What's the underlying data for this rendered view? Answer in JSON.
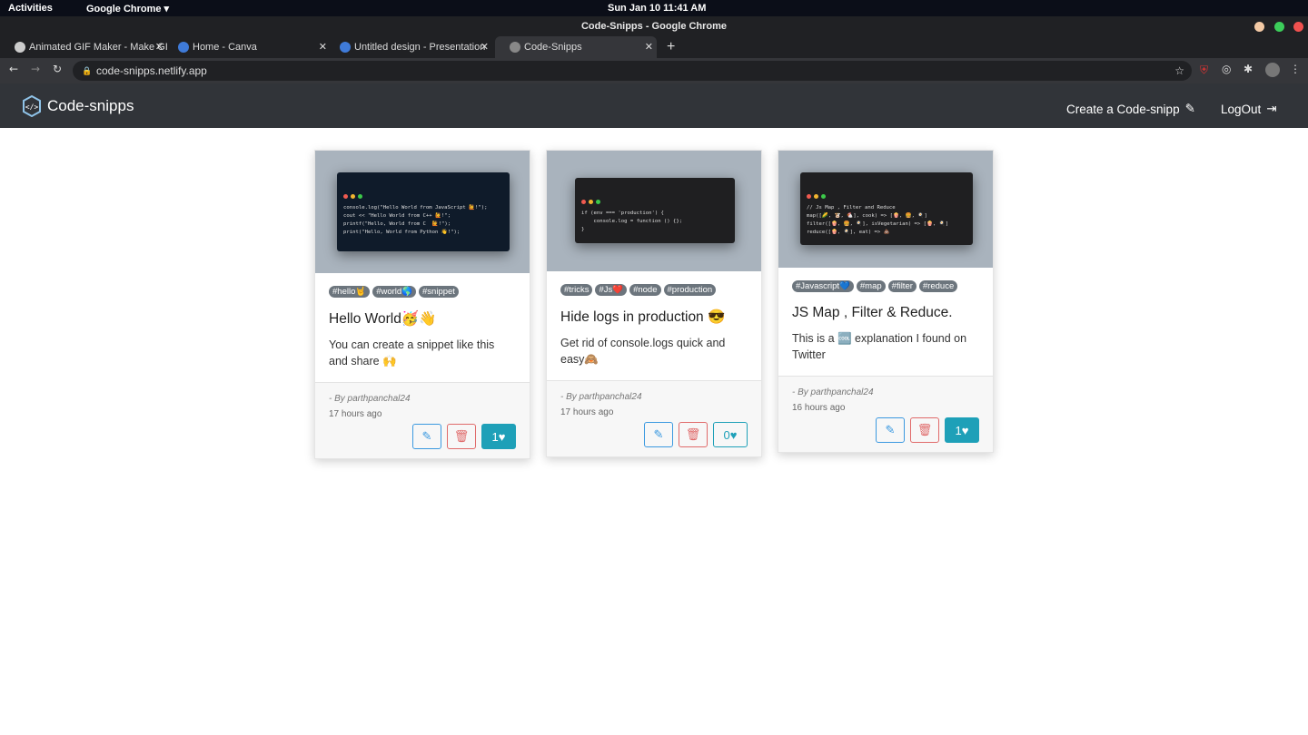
{
  "system": {
    "activities": "Activities",
    "app": "Google Chrome ▾",
    "clock": "Sun Jan 10  11:41 AM"
  },
  "window": {
    "title": "Code-Snipps - Google Chrome"
  },
  "tabs": [
    {
      "label": "Animated GIF Maker - Make GIFs"
    },
    {
      "label": "Home - Canva"
    },
    {
      "label": "Untitled design - Presentation"
    },
    {
      "label": "Code-Snipps",
      "active": true
    }
  ],
  "address": {
    "url": "code-snipps.netlify.app"
  },
  "nav": {
    "brand": "Code-snipps",
    "create": "Create a Code-snipp",
    "logout": "LogOut"
  },
  "colors": {
    "navbar": "#313439",
    "tag": "#6c757d",
    "like": "#1ea0b8",
    "edit": "#3b99e0",
    "delete": "#e06a6a"
  },
  "cards": [
    {
      "code": [
        "console.log(\"Hello World from JavaScript 🙋!\");",
        "",
        "cout << \"Hello World from C++ 🙋!\";",
        "",
        "printf(\"Hello, World from C  🙋!\");",
        "",
        "print(\"Hello, World from Python 👋!\");"
      ],
      "tags": [
        "#hello🤘",
        "#world🌎",
        "#snippet"
      ],
      "title": "Hello World🥳👋",
      "desc": "You can create a snippet like this and share 🙌",
      "author": "- By parthpanchal24",
      "time": "17 hours ago",
      "likes": "1",
      "liked": true
    },
    {
      "code": [
        "if (env === 'production') {",
        "    console.log = function () {};",
        "}"
      ],
      "tags": [
        "#tricks",
        "#Js❤️",
        "#node",
        "#production"
      ],
      "title": "Hide logs in production 😎",
      "desc": "Get rid of console.logs quick and easy🙈",
      "author": "- By parthpanchal24",
      "time": "17 hours ago",
      "likes": "0",
      "liked": false
    },
    {
      "code": [
        "// Js Map , Filter and Reduce",
        "map([🌽, 🐮, 🐔], cook) => [🍿, 🍔, 🍳]",
        "",
        "filter([🍿, 🍔, 🍳], isVegetarian) => [🍿, 🍳]",
        "",
        "reduce([🍿, 🍳], eat) => 💩"
      ],
      "tags": [
        "#Javascript💙",
        "#map",
        "#filter",
        "#reduce"
      ],
      "title": "JS Map , Filter & Reduce.",
      "desc": "This is a 🆒 explanation I found on Twitter",
      "author": "- By parthpanchal24",
      "time": "16 hours ago",
      "likes": "1",
      "liked": true
    }
  ]
}
